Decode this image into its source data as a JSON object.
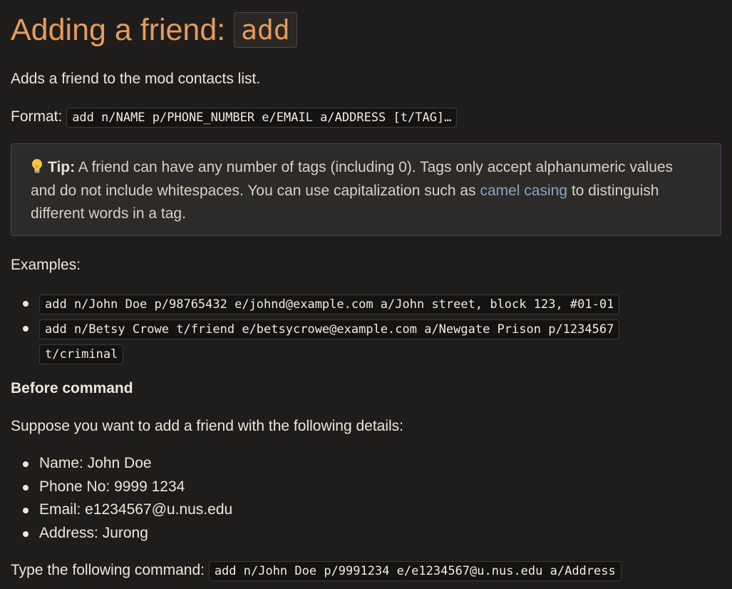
{
  "heading": {
    "prefix": "Adding a friend: ",
    "code": "add"
  },
  "description": "Adds a friend to the mod contacts list.",
  "format": {
    "label": "Format: ",
    "code": "add n/NAME p/PHONE_NUMBER e/EMAIL a/ADDRESS [t/TAG]…"
  },
  "tip": {
    "icon": "lightbulb-icon",
    "label": "Tip:",
    "text_before": " A friend can have any number of tags (including 0). Tags only accept alphanumeric values and do not include whitespaces. You can use capitalization such as ",
    "link": "camel casing",
    "text_after": " to distinguish different words in a tag."
  },
  "examples_label": "Examples:",
  "examples": [
    "add n/John Doe p/98765432 e/johnd@example.com a/John street, block 123, #01-01",
    "add n/Betsy Crowe t/friend e/betsycrowe@example.com a/Newgate Prison p/1234567",
    "t/criminal"
  ],
  "before_command": "Before command",
  "suppose": "Suppose you want to add a friend with the following details:",
  "details": [
    "Name: John Doe",
    "Phone No: 9999 1234",
    "Email: e1234567@u.nus.edu",
    "Address: Jurong"
  ],
  "type_command": {
    "label": "Type the following command: ",
    "code": "add n/John Doe p/9991234 e/e1234567@u.nus.edu a/Address"
  },
  "colors": {
    "background": "#1f1d1c",
    "heading": "#e69b5a",
    "link": "#8aa3bd",
    "text": "#eee7d8"
  }
}
